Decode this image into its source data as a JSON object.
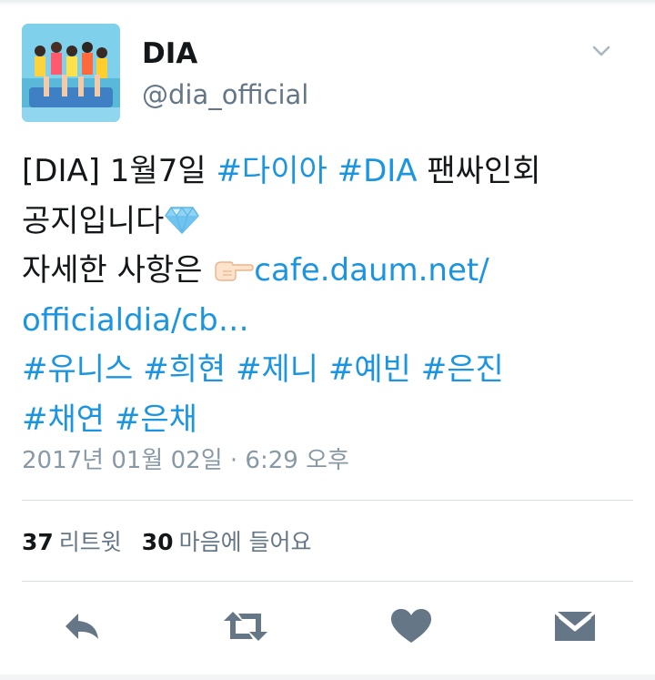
{
  "tweet": {
    "display_name": "DIA",
    "handle": "@dia_official",
    "lines": [
      [
        {
          "text": "[DIA] 1월7일 ",
          "link": false
        },
        {
          "text": "#다이아",
          "link": true
        },
        {
          "text": " ",
          "link": false
        },
        {
          "text": "#DIA",
          "link": true
        },
        {
          "text": " 팬싸인회",
          "link": false
        }
      ],
      [
        {
          "text": "공지입니다",
          "link": false
        }
      ],
      [
        {
          "text": "자세한 사항은 ",
          "link": false
        }
      ],
      [
        {
          "text": "officialdia/cb…",
          "link": true
        }
      ],
      [
        {
          "text": "#유니스",
          "link": true
        },
        {
          "text": " ",
          "link": false
        },
        {
          "text": "#희현",
          "link": true
        },
        {
          "text": " ",
          "link": false
        },
        {
          "text": "#제니",
          "link": true
        },
        {
          "text": " ",
          "link": false
        },
        {
          "text": "#예빈",
          "link": true
        },
        {
          "text": " ",
          "link": false
        },
        {
          "text": "#은진",
          "link": true
        }
      ],
      [
        {
          "text": "#채연",
          "link": true
        },
        {
          "text": " ",
          "link": false
        },
        {
          "text": "#은채",
          "link": true
        }
      ]
    ],
    "link_url": "cafe.daum.net/",
    "timestamp": "2017년 01월 02일 · 6:29 오후",
    "emoji": {
      "diamond": "gem-stone-icon",
      "pointing": "backhand-pointing-right-icon"
    }
  },
  "stats": {
    "retweets": {
      "count": "37",
      "label": "리트윗"
    },
    "likes": {
      "count": "30",
      "label": "마음에 들어요"
    }
  },
  "actions": {
    "reply_icon": "reply-icon",
    "retweet_icon": "retweet-icon",
    "like_icon": "heart-icon",
    "message_icon": "direct-message-icon"
  },
  "colors": {
    "link": "#1b95e0",
    "text": "#14171a",
    "secondary": "#657786",
    "action_icon": "#657786"
  }
}
